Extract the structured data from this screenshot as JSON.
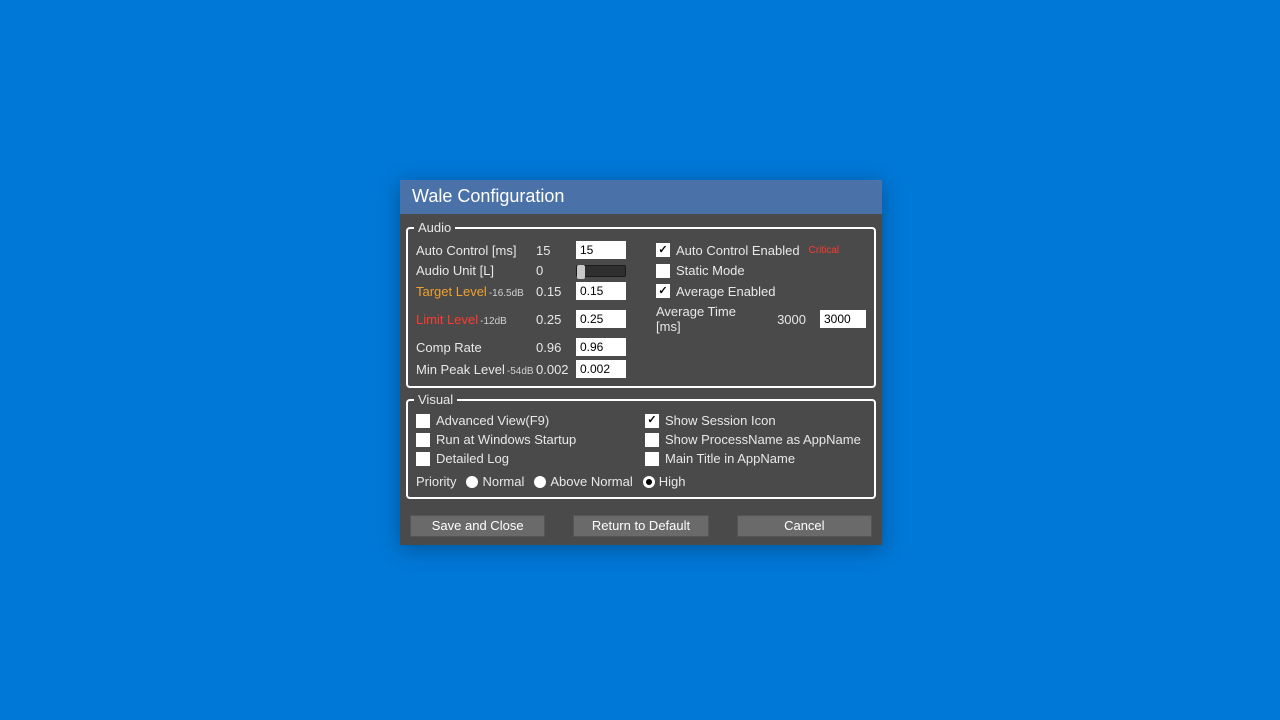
{
  "window": {
    "title": "Wale Configuration"
  },
  "groups": {
    "audio": "Audio",
    "visual": "Visual"
  },
  "audio": {
    "auto_control": {
      "label": "Auto Control [ms]",
      "value_display": "15",
      "value_input": "15"
    },
    "audio_unit": {
      "label": "Audio Unit [L]",
      "value_display": "0"
    },
    "target_level": {
      "label": "Target Level",
      "db": "-16.5dB",
      "value_display": "0.15",
      "value_input": "0.15"
    },
    "limit_level": {
      "label": "Limit Level",
      "db": "-12dB",
      "value_display": "0.25",
      "value_input": "0.25"
    },
    "comp_rate": {
      "label": "Comp Rate",
      "value_display": "0.96",
      "value_input": "0.96"
    },
    "min_peak": {
      "label": "Min Peak Level",
      "db": "-54dB",
      "value_display": "0.002",
      "value_input": "0.002"
    },
    "auto_control_enabled": {
      "label": "Auto Control Enabled",
      "critical": "Critical",
      "checked": true
    },
    "static_mode": {
      "label": "Static Mode",
      "checked": false
    },
    "average_enabled": {
      "label": "Average Enabled",
      "checked": true
    },
    "average_time": {
      "label": "Average Time [ms]",
      "value_display": "3000",
      "value_input": "3000"
    }
  },
  "visual": {
    "advanced_view": {
      "label": "Advanced View(F9)",
      "checked": false
    },
    "run_at_startup": {
      "label": "Run at Windows Startup",
      "checked": false
    },
    "detailed_log": {
      "label": "Detailed Log",
      "checked": false
    },
    "show_session_icon": {
      "label": "Show Session Icon",
      "checked": true
    },
    "show_procname": {
      "label": "Show ProcessName as AppName",
      "checked": false
    },
    "main_title_app": {
      "label": "Main Title in AppName",
      "checked": false
    },
    "priority_label": "Priority",
    "priority_options": {
      "normal": "Normal",
      "above_normal": "Above Normal",
      "high": "High"
    },
    "priority_selected": "high"
  },
  "buttons": {
    "save": "Save and Close",
    "default": "Return to Default",
    "cancel": "Cancel"
  }
}
